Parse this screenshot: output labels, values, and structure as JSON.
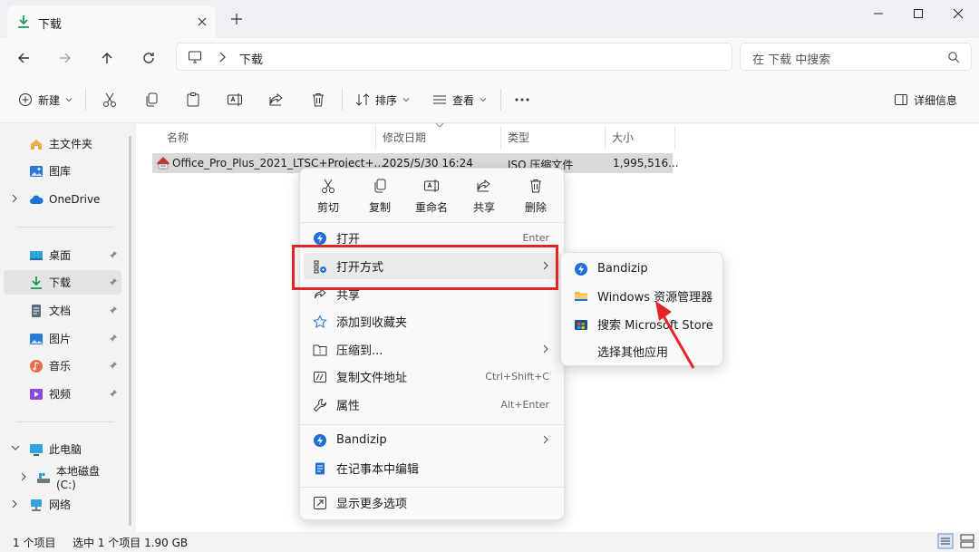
{
  "window": {
    "tab_title": "下载",
    "buttons": [
      "minimize",
      "maximize",
      "close"
    ]
  },
  "nav": {
    "breadcrumb": "下载",
    "search_placeholder": "在 下载 中搜索"
  },
  "toolbar": {
    "new_label": "新建",
    "sort_label": "排序",
    "view_label": "查看",
    "details_label": "详细信息"
  },
  "sidebar": {
    "home": "主文件夹",
    "gallery": "图库",
    "onedrive": "OneDrive",
    "desktop": "桌面",
    "downloads": "下载",
    "documents": "文档",
    "pictures": "图片",
    "music": "音乐",
    "videos": "视频",
    "this_pc": "此电脑",
    "local_disk": "本地磁盘 (C:)",
    "network": "网络"
  },
  "columns": {
    "name": "名称",
    "modified": "修改日期",
    "type": "类型",
    "size": "大小"
  },
  "file": {
    "name": "Office_Pro_Plus_2021_LTSC+Project+...",
    "modified": "2025/5/30 16:24",
    "type": "ISO 压缩文件",
    "size": "1,995,516..."
  },
  "status": {
    "count": "1 个项目",
    "selection": "选中 1 个项目  1.90 GB"
  },
  "context_menu": {
    "quick_actions": {
      "cut": "剪切",
      "copy": "复制",
      "rename": "重命名",
      "share": "共享",
      "delete": "删除"
    },
    "open": "打开",
    "open_shortcut": "Enter",
    "open_with": "打开方式",
    "share": "共享",
    "add_favorites": "添加到收藏夹",
    "compress": "压缩到...",
    "copy_path": "复制文件地址",
    "copy_path_shortcut": "Ctrl+Shift+C",
    "properties": "属性",
    "properties_shortcut": "Alt+Enter",
    "bandizip": "Bandizip",
    "edit_notepad": "在记事本中编辑",
    "more_options": "显示更多选项"
  },
  "submenu": {
    "bandizip": "Bandizip",
    "explorer": "Windows 资源管理器",
    "store": "搜索 Microsoft Store",
    "other_app": "选择其他应用"
  },
  "colors": {
    "accent": "#0067c0",
    "annotation": "#e5242a",
    "selected_row": "#d9d9d9"
  }
}
